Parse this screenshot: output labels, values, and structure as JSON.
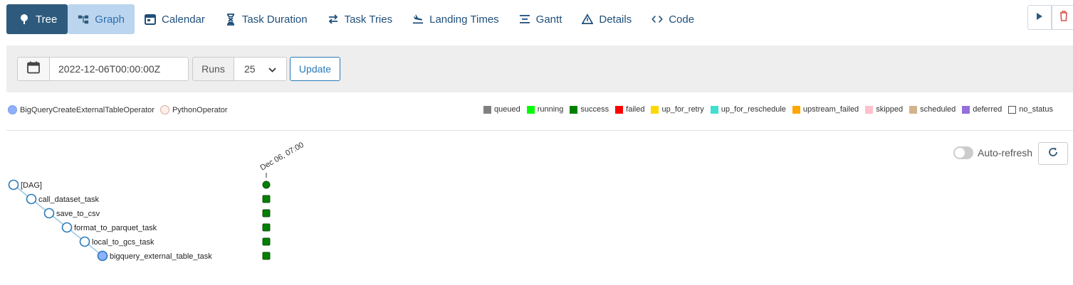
{
  "nav": {
    "tabs": [
      {
        "label": "Tree",
        "icon": "tree-icon",
        "state": "active"
      },
      {
        "label": "Graph",
        "icon": "graph-icon",
        "state": "hover"
      },
      {
        "label": "Calendar",
        "icon": "calendar-icon"
      },
      {
        "label": "Task Duration",
        "icon": "hourglass-icon"
      },
      {
        "label": "Task Tries",
        "icon": "retry-icon"
      },
      {
        "label": "Landing Times",
        "icon": "landing-icon"
      },
      {
        "label": "Gantt",
        "icon": "gantt-icon"
      },
      {
        "label": "Details",
        "icon": "warning-icon"
      },
      {
        "label": "Code",
        "icon": "code-icon"
      }
    ],
    "actions": [
      {
        "icon": "play-icon",
        "color": "#2e5b7d"
      },
      {
        "icon": "trash-icon",
        "color": "#d9534f"
      }
    ]
  },
  "filter": {
    "date_value": "2022-12-06T00:00:00Z",
    "runs_label": "Runs",
    "runs_value": "25",
    "update_label": "Update"
  },
  "operators": [
    {
      "label": "BigQueryCreateExternalTableOperator",
      "color": "#8fb0ff"
    },
    {
      "label": "PythonOperator",
      "color": "#ffefeb"
    }
  ],
  "states": [
    {
      "label": "queued",
      "color": "#808080"
    },
    {
      "label": "running",
      "color": "#00ff00"
    },
    {
      "label": "success",
      "color": "#008000"
    },
    {
      "label": "failed",
      "color": "#ff0000"
    },
    {
      "label": "up_for_retry",
      "color": "#ffd700"
    },
    {
      "label": "up_for_reschedule",
      "color": "#40e0d0"
    },
    {
      "label": "upstream_failed",
      "color": "#ffa500"
    },
    {
      "label": "skipped",
      "color": "#ffc0cb"
    },
    {
      "label": "scheduled",
      "color": "#d2b48c"
    },
    {
      "label": "deferred",
      "color": "#9370db"
    },
    {
      "label": "no_status",
      "color": "#ffffff"
    }
  ],
  "tree": {
    "autorefresh_label": "Auto-refresh",
    "run_label": "Dec 06, 07:00",
    "nodes": [
      {
        "label": "[DAG]",
        "type": "dag",
        "status": "success"
      },
      {
        "label": "call_dataset_task",
        "type": "python",
        "status": "success"
      },
      {
        "label": "save_to_csv",
        "type": "python",
        "status": "success"
      },
      {
        "label": "format_to_parquet_task",
        "type": "python",
        "status": "success"
      },
      {
        "label": "local_to_gcs_task",
        "type": "python",
        "status": "success"
      },
      {
        "label": "bigquery_external_table_task",
        "type": "bigquery",
        "status": "success"
      }
    ]
  }
}
